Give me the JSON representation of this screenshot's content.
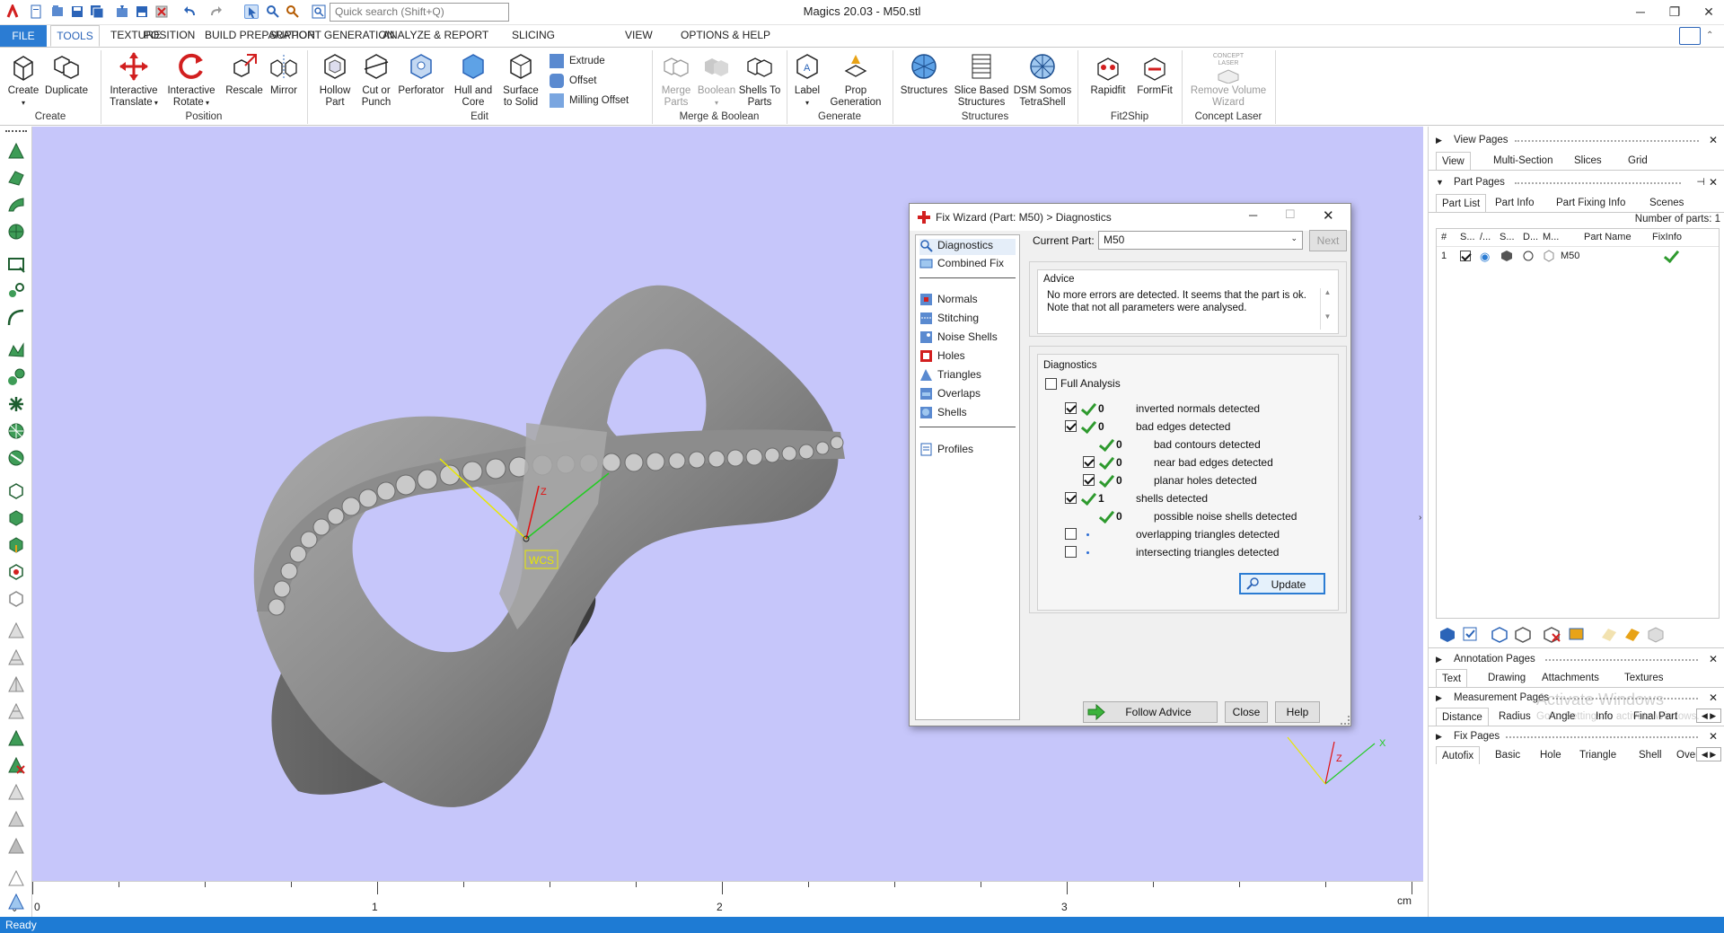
{
  "app": {
    "title": "Magics 20.03 - M50.stl",
    "search_placeholder": "Quick search (Shift+Q)"
  },
  "menu": [
    "FILE",
    "TOOLS",
    "TEXTURE",
    "POSITION",
    "BUILD PREPARATION",
    "SUPPORT GENERATION",
    "ANALYZE & REPORT",
    "SLICING",
    "VIEW",
    "OPTIONS & HELP"
  ],
  "ribbon": {
    "create": {
      "label": "Create",
      "buttons": [
        "Create",
        "Duplicate"
      ]
    },
    "position": {
      "label": "Position",
      "buttons": [
        "Interactive Translate",
        "Interactive Rotate",
        "Rescale",
        "Mirror"
      ]
    },
    "edit": {
      "label": "Edit",
      "buttons": [
        "Hollow Part",
        "Cut or Punch",
        "Perforator",
        "Hull and Core",
        "Surface to Solid"
      ],
      "small": [
        "Extrude",
        "Offset",
        "Milling Offset"
      ]
    },
    "merge": {
      "label": "Merge & Boolean",
      "buttons": [
        "Merge Parts",
        "Boolean",
        "Shells To Parts"
      ]
    },
    "generate": {
      "label": "Generate",
      "buttons": [
        "Label",
        "Prop Generation"
      ]
    },
    "structures": {
      "label": "Structures",
      "buttons": [
        "Structures",
        "Slice Based Structures",
        "DSM Somos TetraShell"
      ]
    },
    "fit2ship": {
      "label": "Fit2Ship",
      "buttons": [
        "Rapidfit",
        "FormFit"
      ]
    },
    "concept": {
      "label": "Concept Laser",
      "buttons": [
        "Remove Volume Wizard"
      ],
      "icon_text": "CONCEPT LASER"
    }
  },
  "viewport": {
    "background": "#c6c6fa",
    "wcs_label": "WCS",
    "axis_z": "Z",
    "axis_x": "X",
    "ruler": {
      "ticks": [
        "0",
        "1",
        "2",
        "3"
      ],
      "unit": "cm"
    }
  },
  "status": "Ready",
  "dialog": {
    "title": "Fix Wizard (Part: M50) > Diagnostics",
    "nav_top": [
      "Diagnostics",
      "Combined Fix"
    ],
    "nav_mid": [
      "Normals",
      "Stitching",
      "Noise Shells",
      "Holes",
      "Triangles",
      "Overlaps",
      "Shells"
    ],
    "nav_bottom": [
      "Profiles"
    ],
    "current_part_label": "Current Part:",
    "current_part_value": "M50",
    "next_label": "Next",
    "advice_title": "Advice",
    "advice_text_1": "No more errors are detected. It seems that the part is ok.",
    "advice_text_2": "Note that not all parameters were analysed.",
    "diagnostics_title": "Diagnostics",
    "full_analysis_label": "Full Analysis",
    "rows": [
      {
        "count": "0",
        "text": "inverted normals detected"
      },
      {
        "count": "0",
        "text": "bad edges detected"
      },
      {
        "count": "0",
        "text": "bad contours detected"
      },
      {
        "count": "0",
        "text": "near bad edges detected"
      },
      {
        "count": "0",
        "text": "planar holes detected"
      },
      {
        "count": "1",
        "text": "shells detected"
      },
      {
        "count": "0",
        "text": "possible noise shells detected"
      },
      {
        "count": "",
        "text": "overlapping triangles detected"
      },
      {
        "count": "",
        "text": "intersecting triangles detected"
      }
    ],
    "update_label": "Update",
    "follow_label": "Follow Advice",
    "close_label": "Close",
    "help_label": "Help"
  },
  "panel": {
    "view_pages": {
      "title": "View Pages",
      "tabs": [
        "View",
        "Multi-Section",
        "Slices",
        "Grid"
      ]
    },
    "part_pages": {
      "title": "Part Pages",
      "tabs": [
        "Part List",
        "Part Info",
        "Part Fixing Info",
        "Scenes"
      ],
      "num_parts": "Number of parts: 1",
      "columns": [
        "#",
        "S...",
        "/...",
        "S...",
        "D...",
        "M...",
        "Part Name",
        "FixInfo"
      ],
      "row": {
        "num": "1",
        "name": "M50"
      }
    },
    "annotation_pages": {
      "title": "Annotation Pages",
      "tabs": [
        "Text",
        "Drawing",
        "Attachments",
        "Textures"
      ]
    },
    "measurement_pages": {
      "title": "Measurement Pages",
      "tabs": [
        "Distance",
        "Radius",
        "Angle",
        "Info",
        "Final Part"
      ]
    },
    "fix_pages": {
      "title": "Fix Pages",
      "tabs": [
        "Autofix",
        "Basic",
        "Hole",
        "Triangle",
        "Shell",
        "Over"
      ]
    },
    "watermark_1": "Activate Windows",
    "watermark_2": "Go to Settings to activate Windows."
  }
}
